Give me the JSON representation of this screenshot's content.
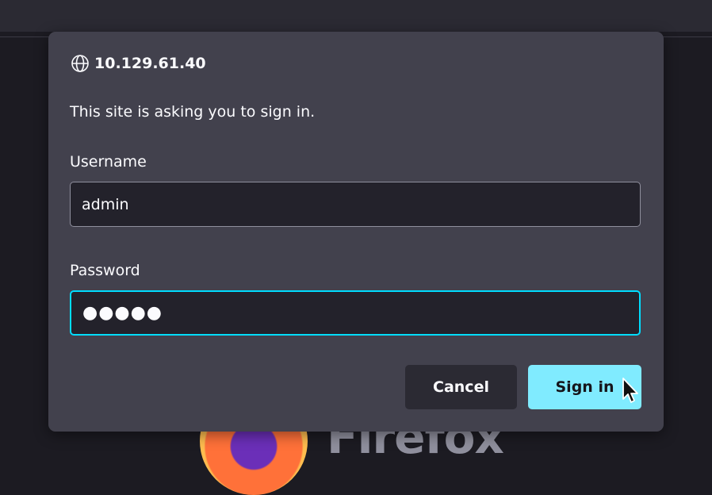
{
  "dialog": {
    "host": "10.129.61.40",
    "message": "This site is asking you to sign in.",
    "username_label": "Username",
    "username_value": "admin",
    "password_label": "Password",
    "password_value": "●●●●●",
    "cancel_label": "Cancel",
    "signin_label": "Sign in"
  },
  "background": {
    "wordmark": "Firefox"
  },
  "icons": {
    "header": "globe-icon",
    "pointer": "mouse-cursor-icon"
  },
  "colors": {
    "dialog_bg": "#42414d",
    "focus_ring": "#00ddff",
    "primary_button": "#80ebff",
    "secondary_button": "#2b2a33"
  }
}
